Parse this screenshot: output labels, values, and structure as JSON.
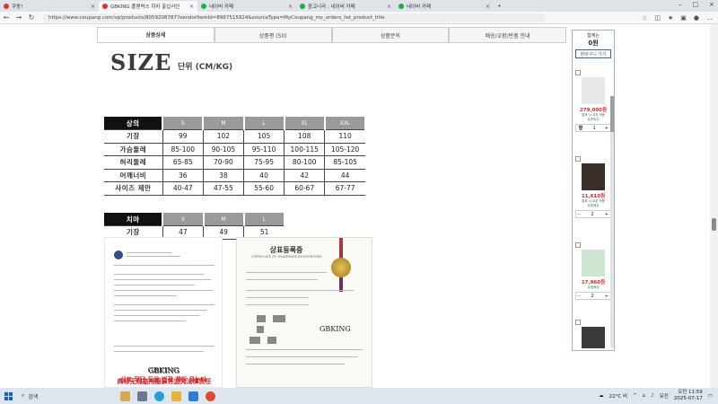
{
  "browser": {
    "tabs": [
      {
        "label": "쿠팡!",
        "color": "#e0312b",
        "active": false
      },
      {
        "label": "GBKING 플랜박스 하차 출입사인",
        "color": "#e0312b",
        "active": true
      },
      {
        "label": "네이버 카페",
        "color": "#16b14a",
        "active": false
      },
      {
        "label": "중고나라 : 네이버 카페",
        "color": "#16b14a",
        "active": false
      },
      {
        "label": "네이버 카페",
        "color": "#16b14a",
        "active": false
      }
    ],
    "url": "https://www.coupang.com/vp/products/8059208787?vendorItemId=8967515924&sourceType=MyCoupang_my_orders_list_product_title"
  },
  "product_tabs": [
    "상품상세",
    "상품평 (50)",
    "상품문의",
    "배송/교환/반품 안내"
  ],
  "size_chart": {
    "title": "SIZE",
    "unit": "단위 (CM/KG)",
    "top_header": [
      "상의",
      "S",
      "M",
      "L",
      "XL",
      "XXL"
    ],
    "top_rows": [
      {
        "label": "기장",
        "values": [
          "99",
          "102",
          "105",
          "108",
          "110"
        ]
      },
      {
        "label": "가슴둘레",
        "values": [
          "85-100",
          "90-105",
          "95-110",
          "100-115",
          "105-120"
        ]
      },
      {
        "label": "허리둘레",
        "values": [
          "65-85",
          "70-90",
          "75-95",
          "80-100",
          "85-105"
        ]
      },
      {
        "label": "어깨너비",
        "values": [
          "36",
          "38",
          "40",
          "42",
          "44"
        ]
      },
      {
        "label": "사이즈 제안",
        "values": [
          "40-47",
          "47-55",
          "55-60",
          "60-67",
          "67-77"
        ]
      }
    ],
    "bottom_header": [
      "치마",
      "S",
      "M",
      "L"
    ],
    "bottom_rows": [
      {
        "label": "기장",
        "values": [
          "47",
          "49",
          "51"
        ]
      }
    ]
  },
  "doc_left": {
    "brand1": "GBKING",
    "red1": "商标无规盗用服装将追究法律责任",
    "brand2": "GBKING",
    "red2": "상표 무단 도용 법적 책임 묻는다"
  },
  "doc_right": {
    "title": "상표등록증",
    "subtitle": "CERTIFICATE OF TRADEMARK REGISTRATION",
    "brand": "GBKING"
  },
  "sidebar": {
    "header": "합계는",
    "count": "0원",
    "cart_button": "장바구니 가기",
    "items": [
      {
        "price": "279,000원",
        "note": "결제 시 쿠폰 적용",
        "badge": "로켓와우",
        "qty": "1",
        "img": "#e8e8e8"
      },
      {
        "price": "11,610원",
        "note": "결제 시 쿠폰 적용",
        "badge": "로켓배송",
        "qty": "2",
        "img": "#3a2e28"
      },
      {
        "price": "17,960원",
        "note": "",
        "badge": "로켓배송",
        "qty": "2",
        "img": "#cfe6d2"
      }
    ]
  },
  "taskbar": {
    "search": "검색",
    "weather": "22°C 비",
    "lang": "유전",
    "time": "오전 11:59",
    "date": "2025-07-17"
  }
}
